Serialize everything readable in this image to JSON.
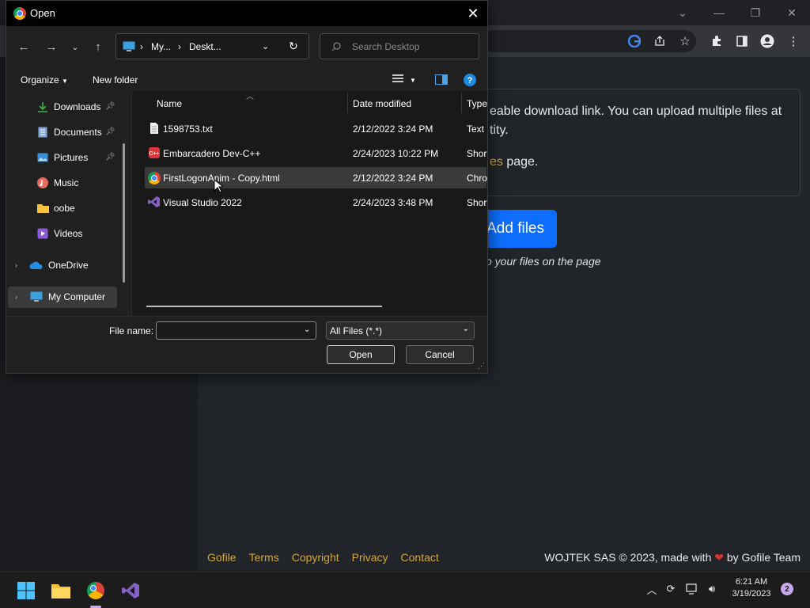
{
  "browser": {
    "window_controls": [
      "⌄",
      "—",
      "❐",
      "✕"
    ],
    "card": {
      "line1": "eable download link. You can upload multiple files at",
      "line2": "tity.",
      "line3_link": "es",
      "line3_rest": " page."
    },
    "add_files_label": "Add files",
    "drop_hint": "o your files on the page",
    "footer_links": [
      "Gofile",
      "Terms",
      "Copyright",
      "Privacy",
      "Contact"
    ],
    "footer_right_pre": "WOJTEK SAS © 2023, made with ",
    "footer_right_post": " by Gofile Team",
    "accent": "#0d6efd",
    "link_color": "#d4a63a"
  },
  "dialog": {
    "title": "Open",
    "address": {
      "seg1": "My...",
      "seg2": "Deskt..."
    },
    "search_placeholder": "Search Desktop",
    "cmdbar": {
      "organize": "Organize",
      "new_folder": "New folder"
    },
    "nav_items": [
      {
        "label": "Downloads",
        "icon": "download-icon",
        "pinned": true
      },
      {
        "label": "Documents",
        "icon": "documents-icon",
        "pinned": true
      },
      {
        "label": "Pictures",
        "icon": "pictures-icon",
        "pinned": true
      },
      {
        "label": "Music",
        "icon": "music-icon",
        "pinned": false
      },
      {
        "label": "oobe",
        "icon": "folder-icon",
        "pinned": false
      },
      {
        "label": "Videos",
        "icon": "videos-icon",
        "pinned": false
      },
      {
        "label": "OneDrive",
        "icon": "cloud-icon",
        "pinned": false
      },
      {
        "label": "My Computer",
        "icon": "computer-icon",
        "pinned": false
      }
    ],
    "columns": {
      "name": "Name",
      "date": "Date modified",
      "type": "Type"
    },
    "files": [
      {
        "name": "1598753.txt",
        "date": "2/12/2022 3:24 PM",
        "type": "Text D",
        "icon": "text-file-icon"
      },
      {
        "name": "Embarcadero Dev-C++",
        "date": "2/24/2023 10:22 PM",
        "type": "Short",
        "icon": "devcpp-icon"
      },
      {
        "name": "FirstLogonAnim - Copy.html",
        "date": "2/12/2022 3:24 PM",
        "type": "Chro",
        "icon": "chrome-icon"
      },
      {
        "name": "Visual Studio 2022",
        "date": "2/24/2023 3:48 PM",
        "type": "Short",
        "icon": "visual-studio-icon"
      }
    ],
    "file_name_label": "File name:",
    "file_name_value": "",
    "filter_value": "All Files (*.*)",
    "open_label": "Open",
    "cancel_label": "Cancel"
  },
  "taskbar": {
    "time": "6:21 AM",
    "date": "3/19/2023",
    "notification_count": "2"
  }
}
